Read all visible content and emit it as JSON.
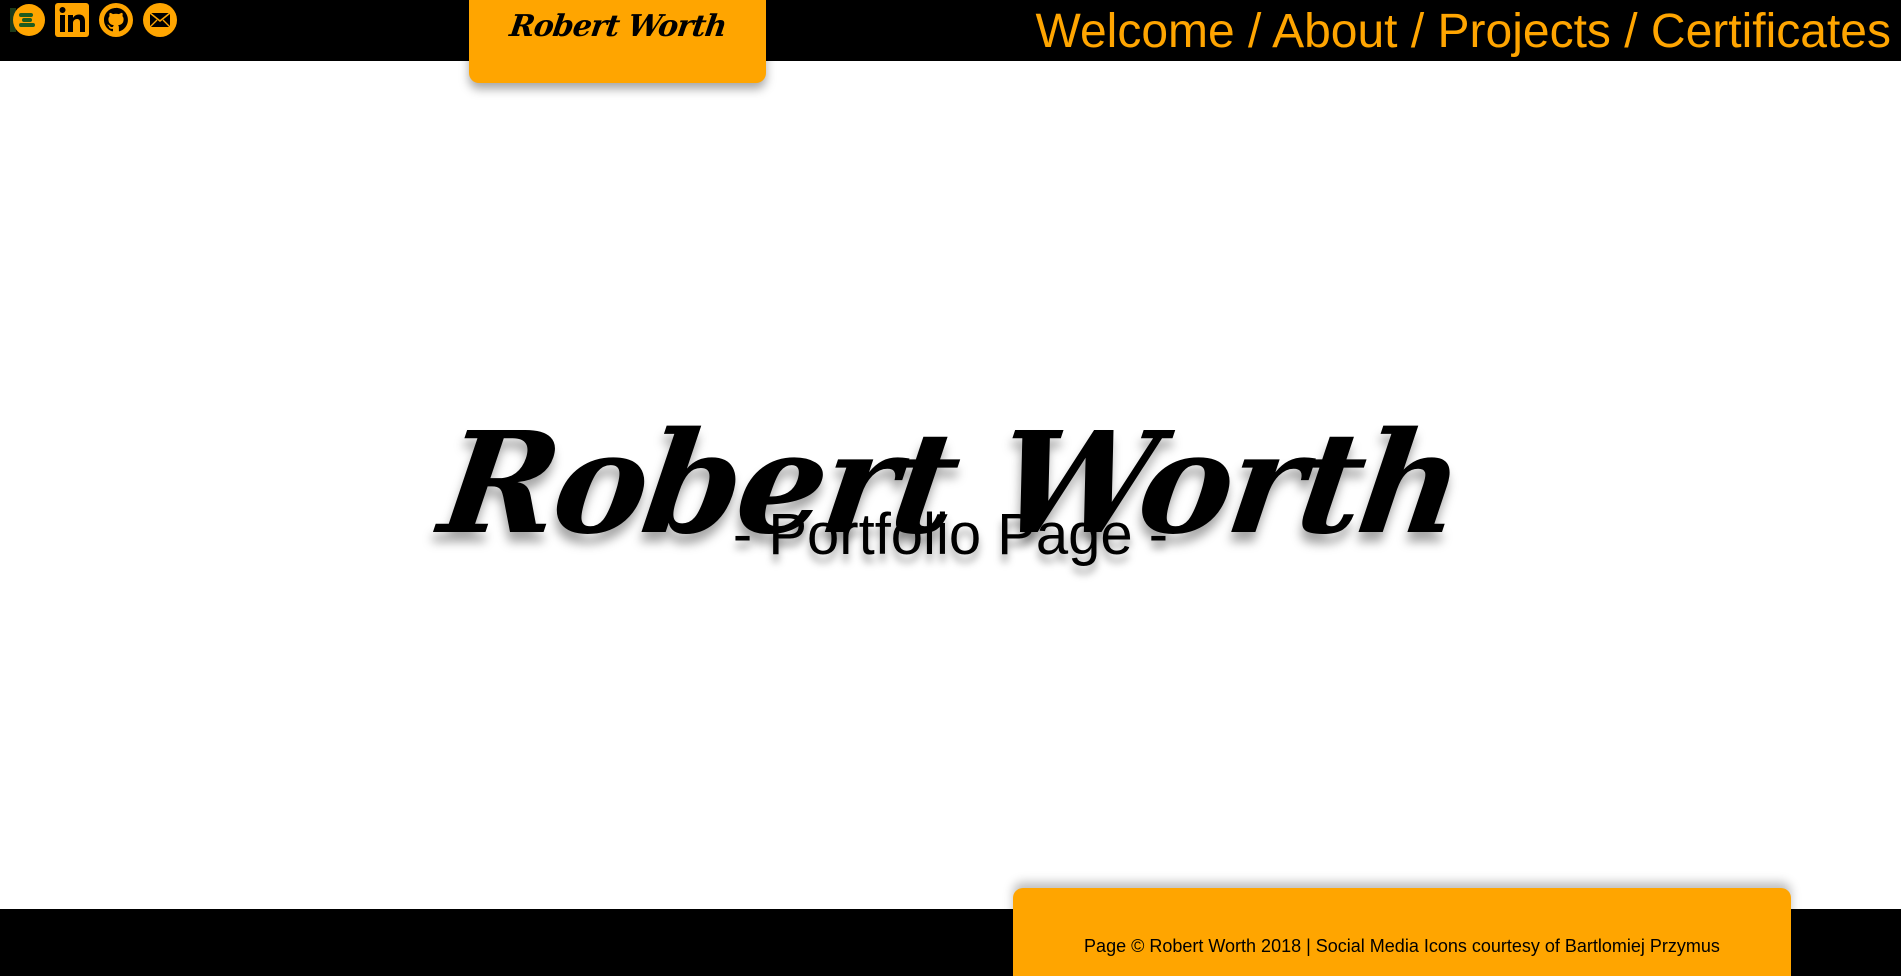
{
  "colors": {
    "accent": "#ffa500",
    "bar": "#000000",
    "background": "#ffffff",
    "text": "#000000"
  },
  "social": [
    {
      "name": "freecodecamp-icon"
    },
    {
      "name": "linkedin-icon"
    },
    {
      "name": "github-icon"
    },
    {
      "name": "email-icon"
    }
  ],
  "header": {
    "name_tab": "Robert Worth",
    "nav": {
      "welcome": "Welcome",
      "about": "About",
      "projects": "Projects",
      "certificates": "Certificates",
      "separator": " / "
    }
  },
  "hero": {
    "title": "Robert Worth",
    "subtitle": "- Portfolio Page -"
  },
  "footer": {
    "text": "Page © Robert Worth 2018 | Social Media Icons courtesy of Bartlomiej Przymus"
  }
}
